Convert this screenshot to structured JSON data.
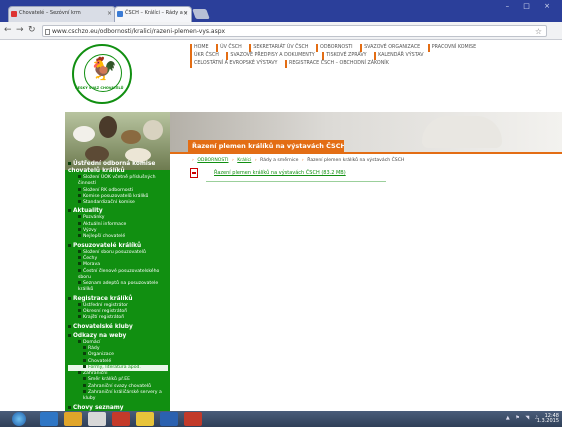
{
  "browser": {
    "tabs": [
      {
        "label": "Chovatelé – Sezóvní krm",
        "active": false
      },
      {
        "label": "ČSCH – Králíci – Rády a v",
        "active": true
      }
    ],
    "url": "www.cschzo.eu/odbornosti/kralici/razeni-plemen-vys.aspx",
    "window_controls": "– □ ×"
  },
  "site": {
    "logo_text": "ČESKÝ SVAZ CHOVATELŮ",
    "topnav": [
      [
        "Home",
        "ÚV ČSCH",
        "Sekretariát ÚV ČSCH",
        "Odbornosti",
        "Svazové organizace",
        "Pracovní komise"
      ],
      [
        "Úkr ČSCH",
        "Svazové předpisy a dokumenty",
        "Tiskové zprávy",
        "Kalendář výstav"
      ],
      [
        "Celostátní a evropské výstavy",
        "Registrace ČSCH – Obchodní zákoník"
      ]
    ],
    "heading": "Řazení plemen králíků na výstavách ČSCH",
    "breadcrumb": [
      "ODBORNOSTI",
      "Králíci",
      "Rády a směrnice",
      "Řazení plemen králíků na výstavách ČSCH"
    ],
    "document": "Řazení plemen králíků na výstavách ČSCH (83.2 MB)"
  },
  "menu": [
    {
      "type": "sec",
      "label": "Ústřední odborná komise chovatelů králíků"
    },
    {
      "type": "it",
      "label": "Složení ÚOK včetně příslušných činností"
    },
    {
      "type": "it",
      "label": "Složení RK odbornosti"
    },
    {
      "type": "it",
      "label": "Komise posuzovatelů králíků"
    },
    {
      "type": "it",
      "label": "Standardizační komise"
    },
    {
      "type": "sec",
      "label": "Aktuality"
    },
    {
      "type": "it",
      "label": "Pozvánky"
    },
    {
      "type": "it",
      "label": "Aktuální informace"
    },
    {
      "type": "it",
      "label": "Výzvy"
    },
    {
      "type": "it",
      "label": "Nejlepší chovatelé"
    },
    {
      "type": "sec",
      "label": "Posuzovatelé králíků"
    },
    {
      "type": "it",
      "label": "Složení sboru posuzovatelů"
    },
    {
      "type": "it",
      "label": "Čechy"
    },
    {
      "type": "it",
      "label": "Morava"
    },
    {
      "type": "it",
      "label": "Čestní členové posuzovatelského sboru"
    },
    {
      "type": "it",
      "label": "Seznam adeptů na posuzovatele králíků"
    },
    {
      "type": "sec",
      "label": "Registrace králíků"
    },
    {
      "type": "it",
      "label": "Ústřední registrátor"
    },
    {
      "type": "it",
      "label": "Okresní registrátoři"
    },
    {
      "type": "it",
      "label": "Krajští registrátoři"
    },
    {
      "type": "sec",
      "label": "Chovatelské kluby"
    },
    {
      "type": "sec",
      "label": "Odkazy na weby"
    },
    {
      "type": "it",
      "label": "Domácí"
    },
    {
      "type": "sub",
      "label": "Rády"
    },
    {
      "type": "sub",
      "label": "Organizace"
    },
    {
      "type": "sub",
      "label": "Chovatelé"
    },
    {
      "type": "sub",
      "label": "Formy, literatura apod.",
      "active": true
    },
    {
      "type": "it",
      "label": "Zahraniční"
    },
    {
      "type": "sub",
      "label": "Směr králíků př.EE"
    },
    {
      "type": "sub",
      "label": "Zahraniční svazy chovatelů"
    },
    {
      "type": "sub",
      "label": "Zahraniční králičárské servery a kluby"
    },
    {
      "type": "sec",
      "label": "Chovy seznamy"
    },
    {
      "type": "it",
      "label": "Plemenné chovy"
    }
  ],
  "taskbar": {
    "tray": "▲ ⚑ ◥ ♪",
    "time": "12:48",
    "date": "1.3.2015"
  }
}
